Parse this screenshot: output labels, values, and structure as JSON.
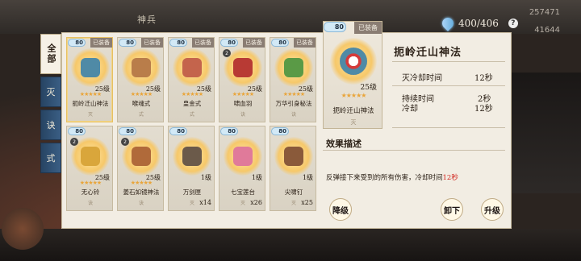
{
  "header": {
    "title": "神兵",
    "numbers": [
      "257471",
      "41644"
    ]
  },
  "currency": {
    "value": "400/406",
    "icon": "water-drop-icon",
    "help_icon": "question-icon",
    "help_label": "?"
  },
  "tabs": [
    {
      "label": "全部",
      "active": true
    },
    {
      "label": "灭"
    },
    {
      "label": "诀"
    },
    {
      "label": "式"
    }
  ],
  "grid": {
    "equipped_label": "已装备",
    "cards": [
      {
        "level_badge": "80",
        "equipped": true,
        "level": "25级",
        "stars": "★★★★★",
        "name": "扼岭迁山神法",
        "element": "灭",
        "selected": true,
        "color": "#4f8aa6"
      },
      {
        "level_badge": "80",
        "equipped": true,
        "level": "25级",
        "stars": "★★★★★",
        "name": "喉魂式",
        "element": "式",
        "color": "#b97d4a"
      },
      {
        "level_badge": "80",
        "equipped": true,
        "level": "25级",
        "stars": "★★★★★",
        "name": "皇金式",
        "element": "式",
        "color": "#c4644c"
      },
      {
        "level_badge": "80",
        "equipped": true,
        "level": "25级",
        "stars": "★★★★★",
        "name": "啸血羽",
        "element": "诀",
        "color": "#b83a34",
        "mark": "2"
      },
      {
        "level_badge": "80",
        "equipped": true,
        "level": "25级",
        "stars": "★★★★★",
        "name": "万华引身秘法",
        "element": "诀",
        "color": "#5a9a46"
      },
      {
        "level_badge": "80",
        "level": "25级",
        "stars": "★★★★★",
        "name": "无心铃",
        "element": "诀",
        "color": "#d9a63b",
        "mark": "2"
      },
      {
        "level_badge": "80",
        "level": "25级",
        "stars": "★★★★★",
        "name": "姜石如镜神法",
        "element": "诀",
        "color": "#b06a3a",
        "mark": "2"
      },
      {
        "level_badge": "80",
        "level": "1级",
        "stars": "",
        "name": "万剑匣",
        "element": "灭",
        "count": "x14",
        "color": "#6b5a4a"
      },
      {
        "level_badge": "80",
        "level": "1级",
        "stars": "",
        "name": "七宝莲台",
        "element": "灭",
        "count": "x26",
        "color": "#e07a9a"
      },
      {
        "level_badge": "80",
        "level": "1级",
        "stars": "",
        "name": "尖啸钉",
        "element": "灭",
        "count": "x25",
        "color": "#8a5a3a"
      }
    ]
  },
  "detail": {
    "level_badge": "80",
    "equipped_label": "已装备",
    "level": "25级",
    "stars": "★★★★★",
    "name": "扼岭迁山神法",
    "element": "灭",
    "title": "扼岭迁山神法",
    "stats": [
      {
        "label": "灭冷却时间",
        "value": "12秒"
      },
      {
        "label": "持续时间",
        "value": "2秒"
      },
      {
        "label": "冷却",
        "value": "12秒"
      }
    ],
    "desc_heading": "效果描述",
    "desc_prefix": "反弹接下来受到的所有伤害，冷却时间",
    "desc_highlight": "12秒",
    "buttons": {
      "downgrade": "降级",
      "unequip": "卸下",
      "upgrade": "升级"
    }
  }
}
